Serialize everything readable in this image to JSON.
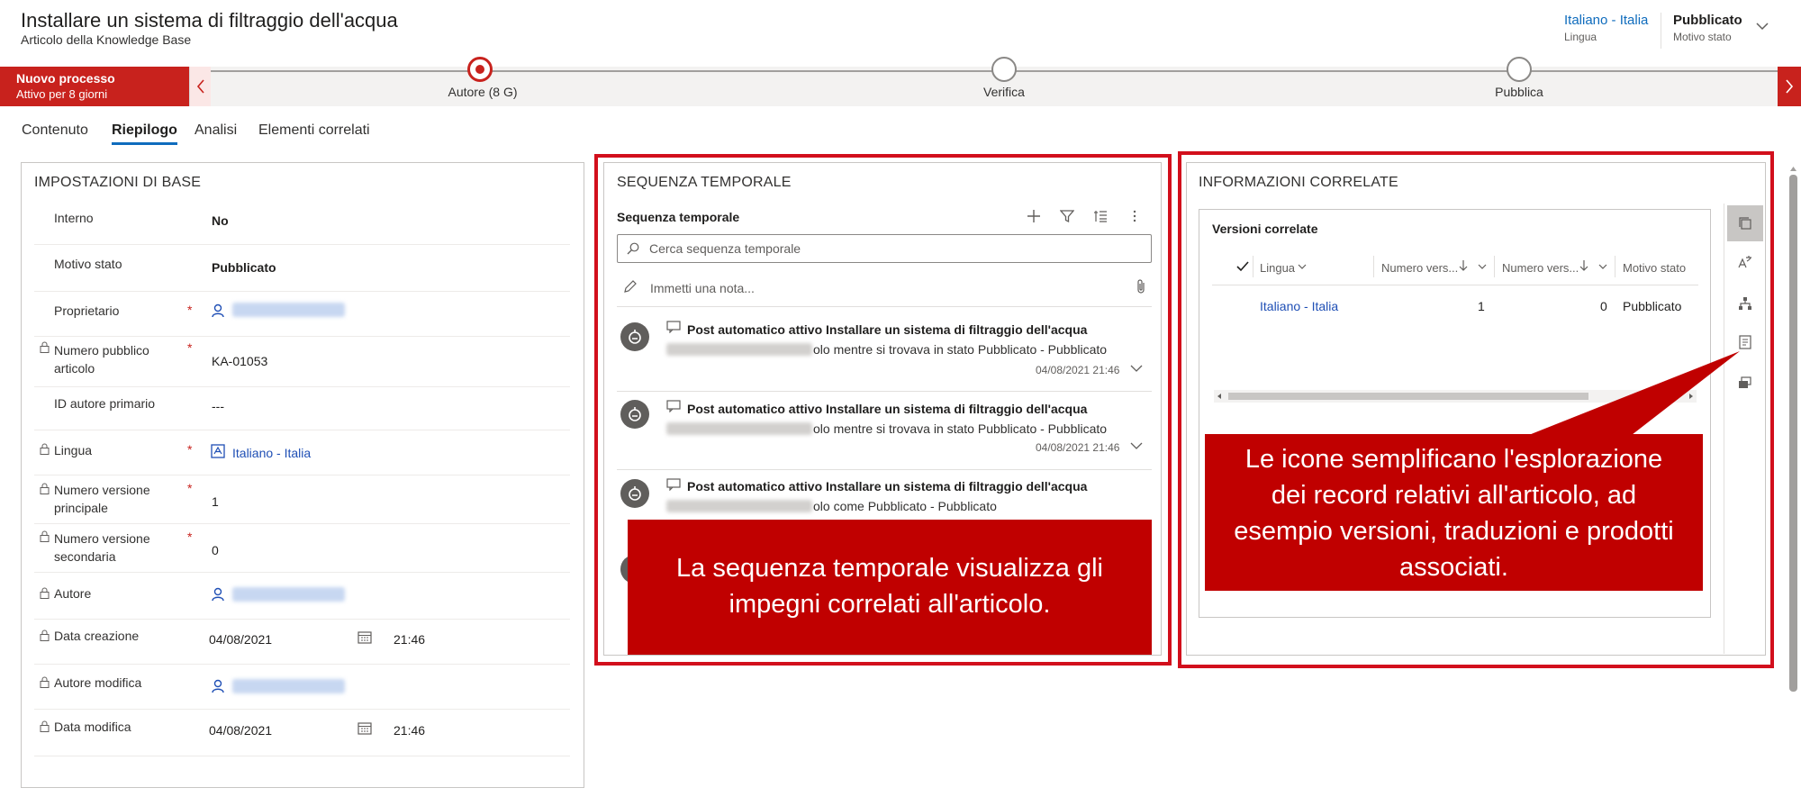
{
  "header": {
    "title": "Installare un sistema di filtraggio dell'acqua",
    "subtitle": "Articolo della Knowledge Base",
    "language_value": "Italiano - Italia",
    "language_caption": "Lingua",
    "status_value": "Pubblicato",
    "status_caption": "Motivo stato"
  },
  "process": {
    "name": "Nuovo processo",
    "active_for": "Attivo per 8 giorni",
    "stages": [
      {
        "label": "Autore  (8 G)",
        "active": true
      },
      {
        "label": "Verifica",
        "active": false
      },
      {
        "label": "Pubblica",
        "active": false
      }
    ]
  },
  "tabs": [
    "Contenuto",
    "Riepilogo",
    "Analisi",
    "Elementi correlati"
  ],
  "basic": {
    "title": "IMPOSTAZIONI DI BASE",
    "fields": [
      {
        "label": "Interno",
        "value": "No"
      },
      {
        "label": "Motivo stato",
        "value": "Pubblicato"
      },
      {
        "label": "Proprietario",
        "value": ""
      },
      {
        "label": "Numero pubblico articolo",
        "value": "KA-01053"
      },
      {
        "label": "ID autore primario",
        "value": "---"
      },
      {
        "label": "Lingua",
        "value": "Italiano - Italia"
      },
      {
        "label": "Numero versione principale",
        "value": "1"
      },
      {
        "label": "Numero versione secondaria",
        "value": "0"
      },
      {
        "label": "Autore",
        "value": ""
      },
      {
        "label": "Data creazione",
        "value": "04/08/2021",
        "time": "21:46"
      },
      {
        "label": "Autore modifica",
        "value": ""
      },
      {
        "label": "Data modifica",
        "value": "04/08/2021",
        "time": "21:46"
      }
    ]
  },
  "timeline": {
    "section_title": "SEQUENZA TEMPORALE",
    "subtitle": "Sequenza temporale",
    "search_placeholder": "Cerca sequenza temporale",
    "note_placeholder": "Immetti una nota...",
    "posts": [
      {
        "title": "Post automatico attivo Installare un sistema di filtraggio dell'acqua",
        "body": "olo mentre si trovava in stato Pubblicato - Pubblicato",
        "date": "04/08/2021 21:46"
      },
      {
        "title": "Post automatico attivo Installare un sistema di filtraggio dell'acqua",
        "body": "olo mentre si trovava in stato Pubblicato - Pubblicato",
        "date": "04/08/2021 21:46"
      },
      {
        "title": "Post automatico attivo Installare un sistema di filtraggio dell'acqua",
        "body": "olo come Pubblicato - Pubblicato",
        "date": ""
      }
    ],
    "callout": "La sequenza temporale visualizza gli impegni correlati all'articolo."
  },
  "related": {
    "section_title": "INFORMAZIONI CORRELATE",
    "subtitle": "Versioni correlate",
    "columns": [
      "Lingua",
      "Numero vers...",
      "Numero vers...",
      "Motivo stato"
    ],
    "row": {
      "lingua": "Italiano - Italia",
      "major": "1",
      "minor": "0",
      "status": "Pubblicato"
    },
    "callout": "Le icone semplificano l'esplorazione dei record relativi all'articolo, ad esempio versioni, traduzioni e prodotti associati.",
    "rail_icons": [
      "versions-icon",
      "translations-icon",
      "hierarchy-icon",
      "knowledge-icon",
      "products-icon"
    ]
  },
  "colors": {
    "accent": "#c8221d",
    "link": "#1f4fb5",
    "callout": "#c00000"
  }
}
